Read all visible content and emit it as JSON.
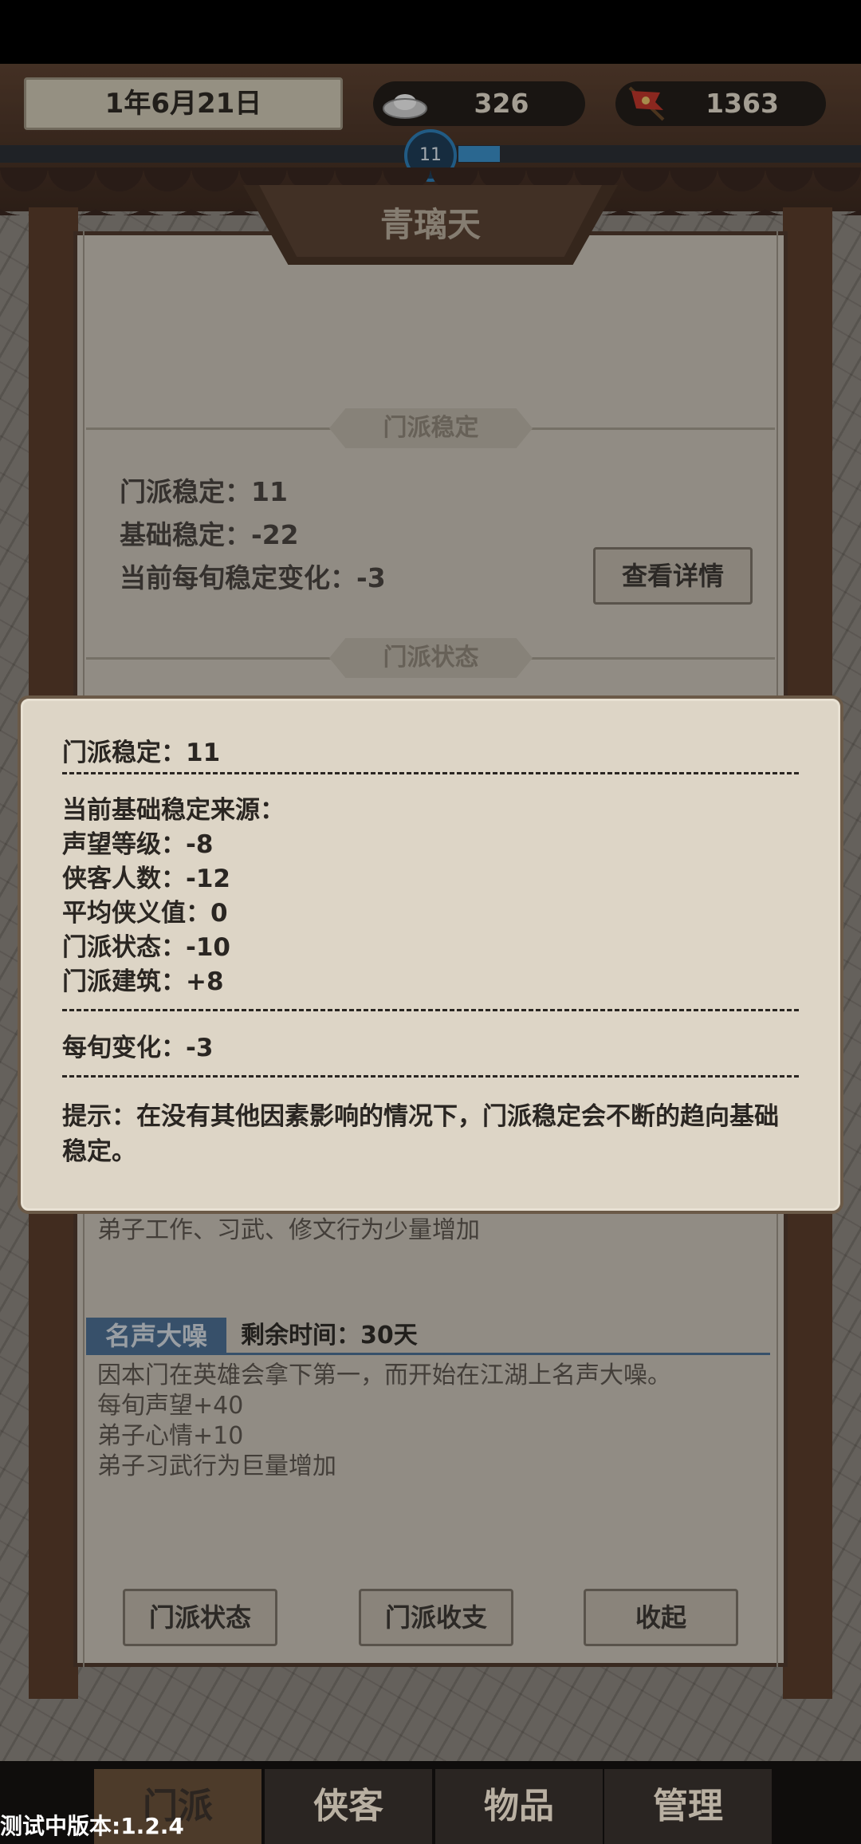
{
  "header": {
    "date": "1年6月21日",
    "silver": "326",
    "reputation": "1363",
    "level": "11",
    "silver_icon": "silver-ingot-icon",
    "flag_icon": "banner-flag-icon"
  },
  "level_progress": 0.08,
  "panel": {
    "title": "青璃天",
    "stability_section": "门派稳定",
    "stability_lines": [
      "门派稳定：11",
      "基础稳定：-22",
      "当前每旬稳定变化：-3"
    ],
    "detail_button": "查看详情",
    "status_section": "门派状态",
    "status_partial_text": "弟子工作、习武、修文行为少量增加",
    "status_name": "名声大噪",
    "status_remaining": "剩余时间：30天",
    "status_desc": [
      "因本门在英雄会拿下第一，而开始在江湖上名声大噪。",
      "每旬声望+40",
      "弟子心情+10",
      "弟子习武行为巨量增加"
    ],
    "buttons": [
      "门派状态",
      "门派收支",
      "收起"
    ]
  },
  "tooltip": {
    "title": "门派稳定：11",
    "source_heading": "当前基础稳定来源：",
    "sources": [
      "声望等级：-8",
      "侠客人数：-12",
      "平均侠义值：0",
      "门派状态：-10",
      "门派建筑：+8"
    ],
    "change": "每旬变化：-3",
    "hint": "提示：在没有其他因素影响的情况下，门派稳定会不断的趋向基础稳定。"
  },
  "nav": {
    "tabs": [
      "门派",
      "侠客",
      "物品",
      "管理"
    ],
    "active": "门派"
  },
  "version": "测试中版本:1.2.4",
  "colors": {
    "accent_blue": "#3b8fc8",
    "status_blue": "#4d6f93",
    "wood": "#4f3a2d",
    "parchment": "#ddd5c6"
  }
}
